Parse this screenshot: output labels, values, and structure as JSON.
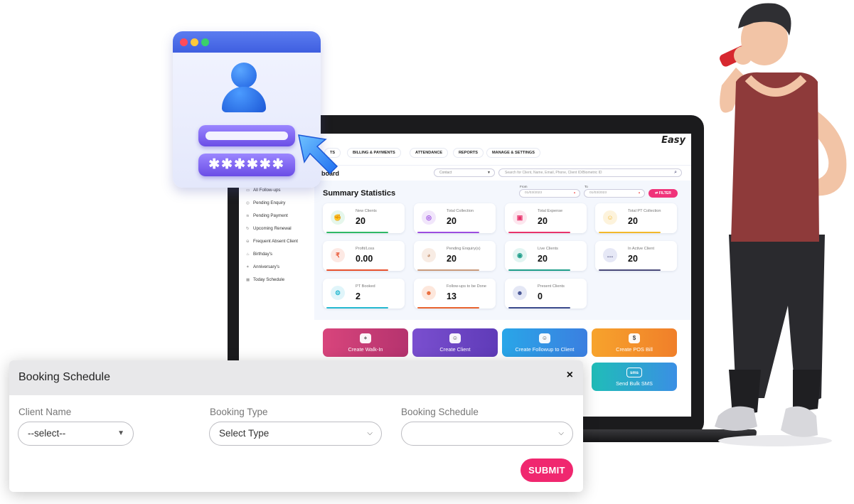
{
  "app": {
    "brand": "Easy",
    "nav_tabs": [
      "TS",
      "BILLING & PAYMENTS",
      "ATTENDANCE",
      "REPORTS",
      "MANAGE & SETTINGS"
    ],
    "page_title": "board",
    "branch_select_placeholder": "Contact",
    "search_placeholder": "Search for Client, Name, Email, Phone, Client ID/Biometric ID"
  },
  "sidebar": {
    "items": [
      {
        "label": "All Follow-ups",
        "icon": "chat-icon"
      },
      {
        "label": "Pending Enquiry",
        "icon": "enquiry-icon"
      },
      {
        "label": "Pending Payment",
        "icon": "payment-icon"
      },
      {
        "label": "Upcoming Renewal",
        "icon": "renewal-icon"
      },
      {
        "label": "Frequent Absent Client",
        "icon": "absent-icon"
      },
      {
        "label": "Birthday's",
        "icon": "cake-icon"
      },
      {
        "label": "Anniversary's",
        "icon": "party-icon"
      },
      {
        "label": "Today Schedule",
        "icon": "calendar-icon"
      }
    ]
  },
  "summary": {
    "title": "Summary Statistics",
    "from_label": "From",
    "to_label": "To",
    "from_value": "01/03/2023",
    "to_value": "01/03/2023",
    "filter_label": "FILTER",
    "stats": [
      {
        "label": "New Clients",
        "value": "20",
        "color": "#2fb866",
        "bg": "#e6f7ec",
        "icon": "muscle-icon",
        "glyph": "✊"
      },
      {
        "label": "Total Collection",
        "value": "20",
        "color": "#9b4de0",
        "bg": "#f1e6fb",
        "icon": "coins-icon",
        "glyph": "◎"
      },
      {
        "label": "Total Expense",
        "value": "20",
        "color": "#e8336b",
        "bg": "#fde6ee",
        "icon": "wallet-icon",
        "glyph": "▣"
      },
      {
        "label": "Total PT Collection",
        "value": "20",
        "color": "#f2b82b",
        "bg": "#fdf3dc",
        "icon": "trainer-icon",
        "glyph": "☺"
      },
      {
        "label": "Profit/Loss",
        "value": "0.00",
        "color": "#e8522f",
        "bg": "#fde9e4",
        "icon": "rupee-icon",
        "glyph": "₹"
      },
      {
        "label": "Pending Enquiry(s)",
        "value": "20",
        "color": "#c99a7c",
        "bg": "#f8ece4",
        "icon": "enquiry-icon",
        "glyph": "◕"
      },
      {
        "label": "Live Clients",
        "value": "20",
        "color": "#1f9e8a",
        "bg": "#e2f5f2",
        "icon": "live-icon",
        "glyph": "◉"
      },
      {
        "label": "In Active Client",
        "value": "20",
        "color": "#4a4a7a",
        "bg": "#e6e8f6",
        "icon": "message-icon",
        "glyph": "…"
      },
      {
        "label": "PT Booked",
        "value": "2",
        "color": "#25b8d0",
        "bg": "#e0f5fa",
        "icon": "dumbbell-icon",
        "glyph": "⚙"
      },
      {
        "label": "Follow-ups to be Done",
        "value": "13",
        "color": "#e8632f",
        "bg": "#fde7dc",
        "icon": "followup-icon",
        "glyph": "☻"
      },
      {
        "label": "Present Clients",
        "value": "0",
        "color": "#3b4a8c",
        "bg": "#e4e7f5",
        "icon": "users-icon",
        "glyph": "☻"
      }
    ]
  },
  "quick_actions": [
    {
      "label": "Create Walk-In",
      "icon": "walk-in-icon",
      "glyph": "+",
      "bg": "linear-gradient(90deg,#d8457c,#b5336e)"
    },
    {
      "label": "Create Client",
      "icon": "client-icon",
      "glyph": "☺",
      "bg": "linear-gradient(90deg,#7a4fcf,#5f3bb8)"
    },
    {
      "label": "Create Followup to Client",
      "icon": "followup-icon",
      "glyph": "☺",
      "bg": "linear-gradient(90deg,#29a6e8,#3b7fe0)"
    },
    {
      "label": "Create POS Bill",
      "icon": "dollar-icon",
      "glyph": "$",
      "bg": "linear-gradient(90deg,#f7a32c,#f07f2a)"
    },
    {
      "label": "Send Bulk SMS",
      "icon": "sms-icon",
      "glyph": "sms",
      "bg": "linear-gradient(90deg,#20bdb8,#3a8fe4)"
    }
  ],
  "login_card": {
    "password_mask": "✱✱✱✱✱✱"
  },
  "modal": {
    "title": "Booking Schedule",
    "close_glyph": "×",
    "fields": [
      {
        "label": "Client Name",
        "value": "--select--"
      },
      {
        "label": "Booking Type",
        "value": "Select Type"
      },
      {
        "label": "Booking Schedule",
        "value": ""
      }
    ],
    "submit_label": "SUBMIT"
  },
  "colors": {
    "accent": "#f0276f",
    "primary_blue": "#3f5fe0",
    "surface": "#f4f7fd"
  }
}
